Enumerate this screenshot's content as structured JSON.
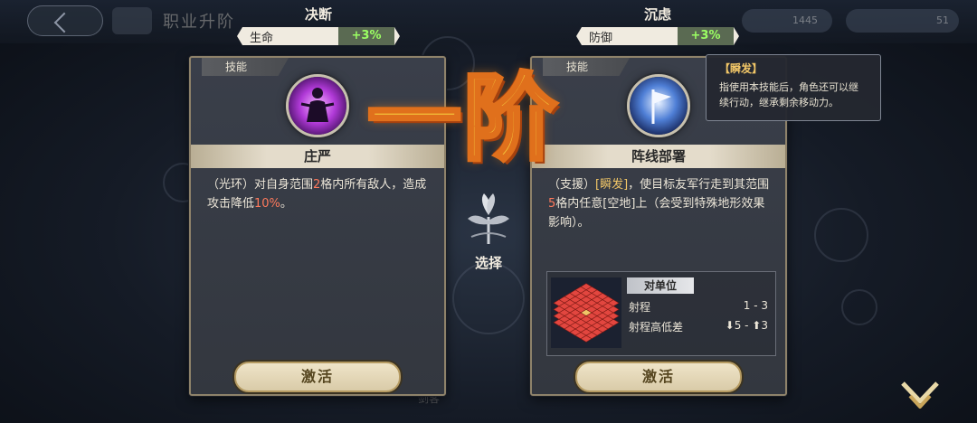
{
  "background": {
    "page_title": "职业升阶",
    "currency_a": "1445",
    "currency_b": "51",
    "bottom_hint": "剑客"
  },
  "left_option": {
    "trait": "决断",
    "stat_name": "生命",
    "stat_value": "+3%",
    "tag": "技能",
    "skill_icon": "figure-aura-icon",
    "skill_name": "庄严",
    "desc_parts": {
      "a": "（光环）对自身范围",
      "b": "2",
      "c": "格内所有敌人，造成攻击降低",
      "d": "10%",
      "e": "。"
    },
    "button": "激活"
  },
  "right_option": {
    "trait": "沉虑",
    "stat_name": "防御",
    "stat_value": "+3%",
    "tag": "技能",
    "skill_icon": "flag-icon",
    "skill_name": "阵线部署",
    "desc_parts": {
      "a": "（支援）",
      "b": "[瞬发]",
      "c": "，使目标友军行走到其范围",
      "d": "5",
      "e": "格内任意[空地]上（会受到特殊地形效果影响）。"
    },
    "target": {
      "title": "对单位",
      "range_label": "射程",
      "range_value": "1 - 3",
      "height_label": "射程高低差",
      "height_value": "⬇5 - ⬆3"
    },
    "button": "激活"
  },
  "tooltip": {
    "heading": "【瞬发】",
    "body": "指使用本技能后，角色还可以继续行动，继承剩余移动力。"
  },
  "banner": "一阶",
  "select_label": "选择",
  "colors": {
    "accent_gold": "#f1c667",
    "highlight_red": "#ff7a5c",
    "stat_green": "#9bff63",
    "card_border": "#8e826a"
  }
}
